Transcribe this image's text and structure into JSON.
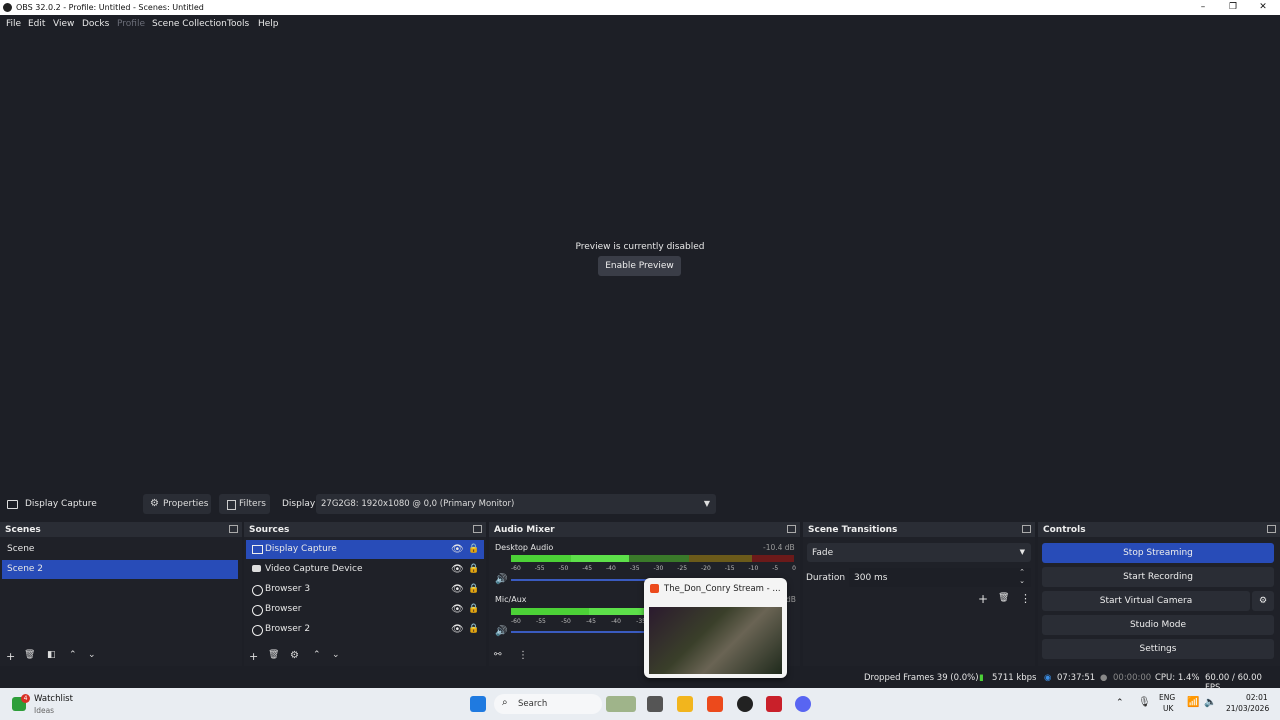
{
  "window": {
    "title": "OBS 32.0.2 - Profile: Untitled - Scenes: Untitled"
  },
  "menu": [
    "File",
    "Edit",
    "View",
    "Docks",
    "Profile",
    "Scene Collection",
    "Tools",
    "Help"
  ],
  "preview": {
    "message": "Preview is currently disabled",
    "enable_label": "Enable Preview"
  },
  "source_toolbar": {
    "source_name": "Display Capture",
    "properties_label": "Properties",
    "filters_label": "Filters",
    "display_label": "Display",
    "display_value": "27G2G8: 1920x1080 @ 0,0 (Primary Monitor)"
  },
  "scenes": {
    "title": "Scenes",
    "items": [
      "Scene",
      "Scene 2"
    ],
    "selected": "Scene 2"
  },
  "sources": {
    "title": "Sources",
    "items": [
      "Display Capture",
      "Video Capture Device",
      "Browser 3",
      "Browser",
      "Browser 2"
    ],
    "selected": "Display Capture"
  },
  "mixer": {
    "title": "Audio Mixer",
    "channels": [
      {
        "name": "Desktop Audio",
        "db": "-10.4 dB"
      },
      {
        "name": "Mic/Aux",
        "db": "dB"
      }
    ],
    "ticks": [
      "-60",
      "-55",
      "-50",
      "-45",
      "-40",
      "-35",
      "-30",
      "-25",
      "-20",
      "-15",
      "-10",
      "-5",
      "0"
    ]
  },
  "transitions": {
    "title": "Scene Transitions",
    "selected": "Fade",
    "duration_label": "Duration",
    "duration_value": "300 ms"
  },
  "controls": {
    "title": "Controls",
    "buttons": [
      "Stop Streaming",
      "Start Recording",
      "Start Virtual Camera",
      "Studio Mode",
      "Settings"
    ]
  },
  "status": {
    "dropped": "Dropped Frames 39 (0.0%)",
    "bitrate": "5711 kbps",
    "stream_time": "07:37:51",
    "rec_time": "00:00:00",
    "cpu": "CPU: 1.4%",
    "fps": "60.00 / 60.00 FPS"
  },
  "popup": {
    "title": "The_Don_Conry Stream - ..."
  },
  "taskbar": {
    "widget_title": "Watchlist",
    "widget_sub": "Ideas",
    "widget_badge": "4",
    "search": "Search",
    "lang_top": "ENG",
    "lang_bottom": "UK",
    "time": "02:01",
    "date": "21/03/2026"
  }
}
